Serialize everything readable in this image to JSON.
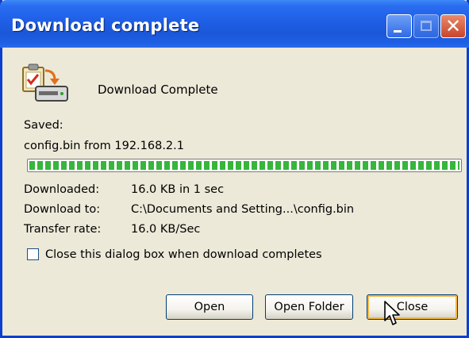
{
  "window": {
    "title": "Download complete"
  },
  "header": {
    "heading": "Download Complete"
  },
  "saved": {
    "label": "Saved:",
    "file": "config.bin from 192.168.2.1"
  },
  "progress": {
    "value": 1.0,
    "color": "#37b53c"
  },
  "details": {
    "downloaded_label": "Downloaded:",
    "downloaded_value": "16.0 KB in 1 sec",
    "download_to_label": "Download to:",
    "download_to_value": "C:\\Documents and Setting...\\config.bin",
    "transfer_rate_label": "Transfer rate:",
    "transfer_rate_value": "16.0 KB/Sec"
  },
  "option": {
    "close_when_complete_label": "Close this dialog box when download completes",
    "checked": false
  },
  "buttons": {
    "open": "Open",
    "open_folder": "Open Folder",
    "close": "Close"
  },
  "icons": {
    "title_minimize": "minimize-icon",
    "title_maximize": "maximize-icon",
    "title_close": "close-icon",
    "file": "download-complete-icon",
    "pointer": "mouse-pointer-icon"
  },
  "colors": {
    "titlebar": "#1e5fe6",
    "window_bg": "#ece9d8",
    "close_button": "#c8452a"
  }
}
